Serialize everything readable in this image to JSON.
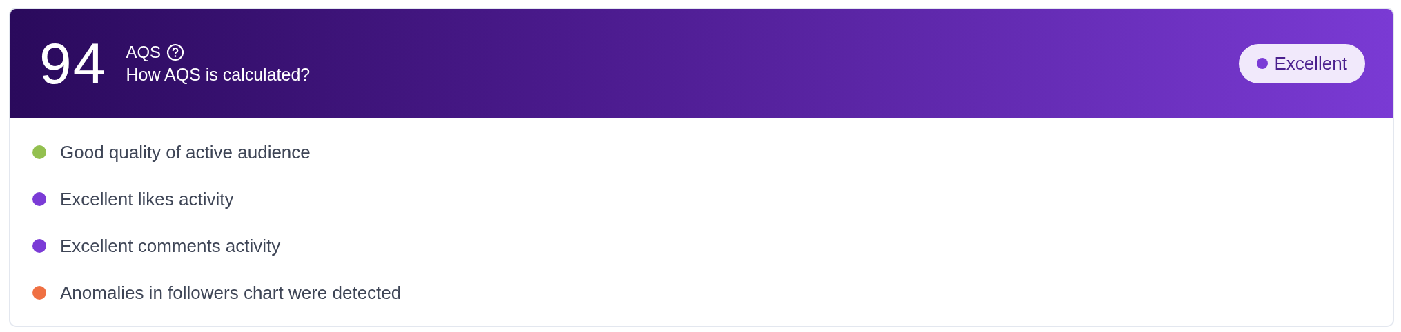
{
  "header": {
    "score": "94",
    "label": "AQS",
    "link": "How AQS is calculated?",
    "badge": {
      "label": "Excellent",
      "color": "#7b3bd6"
    }
  },
  "factors": [
    {
      "text": "Good quality of active audience",
      "color": "#93c04f"
    },
    {
      "text": "Excellent likes activity",
      "color": "#7b3bd6"
    },
    {
      "text": "Excellent comments activity",
      "color": "#7b3bd6"
    },
    {
      "text": "Anomalies in followers chart were detected",
      "color": "#ef7043"
    }
  ]
}
